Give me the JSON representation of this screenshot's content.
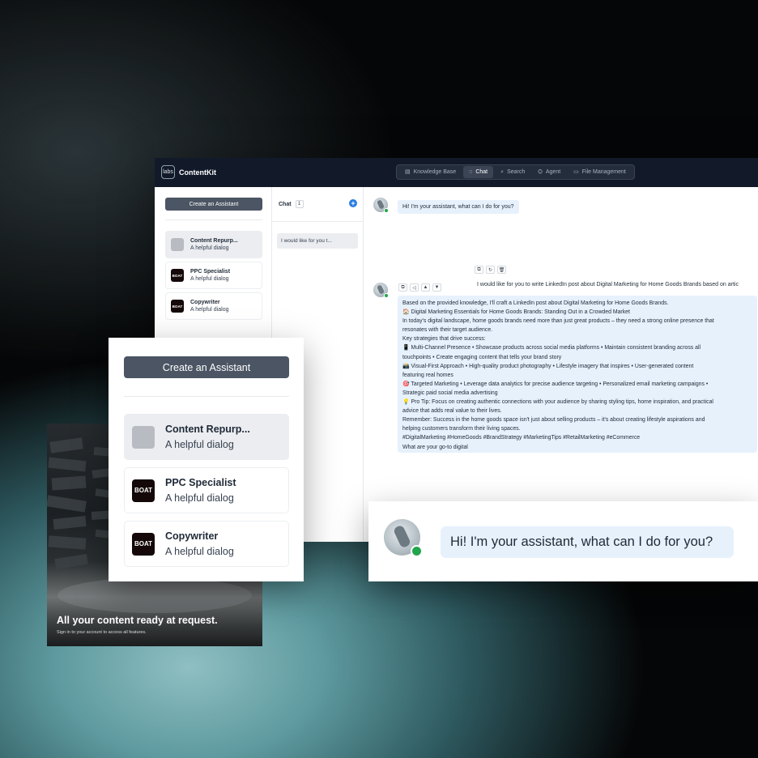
{
  "app": {
    "logo_text": "labs",
    "brand": "ContentKit",
    "nav": [
      {
        "icon": "database-icon",
        "glyph": "🗄",
        "label": "Knowledge Base",
        "active": false
      },
      {
        "icon": "chat-icon",
        "glyph": "◌",
        "label": "Chat",
        "active": true
      },
      {
        "icon": "search-icon",
        "glyph": "⌕",
        "label": "Search",
        "active": false
      },
      {
        "icon": "agent-icon",
        "glyph": "⛭",
        "label": "Agent",
        "active": false
      },
      {
        "icon": "folder-icon",
        "glyph": "▭",
        "label": "File Management",
        "active": false
      }
    ]
  },
  "sidebar": {
    "create_label": "Create an Assistant",
    "assistants": [
      {
        "name": "Content Repurp...",
        "subtitle": "A helpful dialog",
        "avatar": "gray"
      },
      {
        "name": "PPC Specialist",
        "subtitle": "A helpful dialog",
        "avatar": "BOAT"
      },
      {
        "name": "Copywriter",
        "subtitle": "A helpful dialog",
        "avatar": "BOAT"
      }
    ]
  },
  "chatlist": {
    "title": "Chat",
    "count": "1",
    "plus": "+",
    "items": [
      "I would like for you t..."
    ]
  },
  "conversation": {
    "greeting": "Hi! I'm your assistant, what can I do for you?",
    "user_message": "I would like for you to write LinkedIn post about Digital Marketing for Home Goods Brands based on artic",
    "answer_lines": [
      "Based on the provided knowledge, I'll craft a LinkedIn post about Digital Marketing for Home Goods Brands.",
      "🏠 Digital Marketing Essentials for Home Goods Brands: Standing Out in a Crowded Market",
      "In today's digital landscape, home goods brands need more than just great products – they need a strong online presence that",
      "resonates with their target audience.",
      "Key strategies that drive success:",
      "📱 Multi-Channel Presence • Showcase products across social media platforms • Maintain consistent branding across all",
      "touchpoints • Create engaging content that tells your brand story",
      "📸 Visual-First Approach • High-quality product photography • Lifestyle imagery that inspires • User-generated content",
      "featuring real homes",
      "🎯 Targeted Marketing • Leverage data analytics for precise audience targeting • Personalized email marketing campaigns •",
      "Strategic paid social media advertising",
      "💡 Pro Tip: Focus on creating authentic connections with your audience by sharing styling tips, home inspiration, and practical",
      "advice that adds real value to their lives.",
      "Remember: Success in the home goods space isn't just about selling products – it's about creating lifestyle aspirations and",
      "helping customers transform their living spaces.",
      "#DigitalMarketing #HomeGoods #BrandStrategy #MarketingTips #RetailMarketing #eCommerce",
      "What are your go-to digital"
    ],
    "user_actions": [
      "copy-icon",
      "refresh-icon",
      "trash-icon"
    ],
    "answer_actions": [
      "copy-icon",
      "speaker-icon",
      "thumbs-up-icon",
      "thumbs-down-icon"
    ]
  },
  "login": {
    "headline": "All your content ready at request.",
    "subtext": "Sign in to your account to access all features."
  },
  "colors": {
    "topbar": "#121a2a",
    "button": "#4b5563",
    "bubble": "#e6f1fc",
    "online": "#22a54b",
    "accent": "#2a7de1"
  }
}
